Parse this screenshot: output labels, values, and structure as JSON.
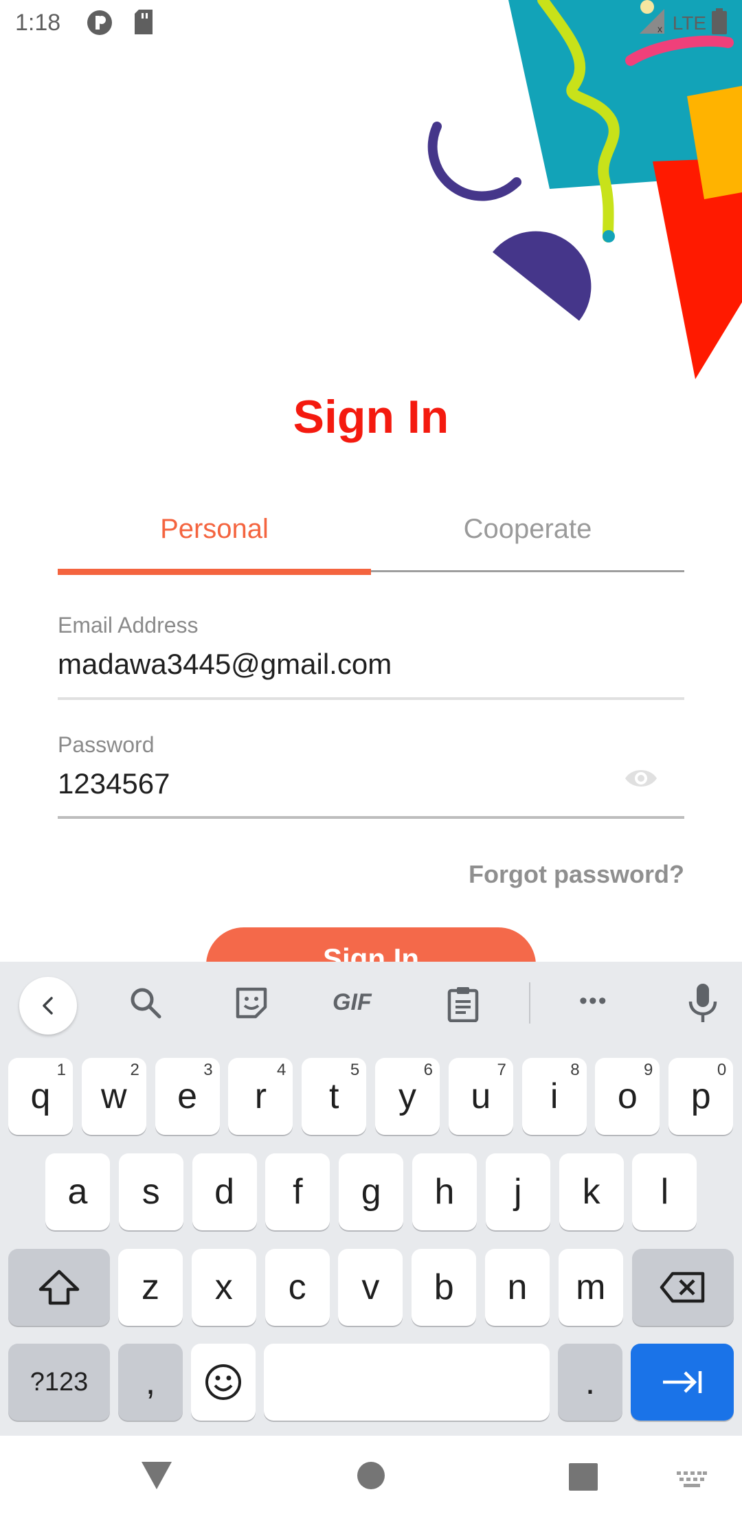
{
  "status_bar": {
    "time": "1:18",
    "icons": [
      "app-icon",
      "sd-card-icon"
    ],
    "network": "LTE",
    "right_icons": [
      "signal-icon",
      "battery-icon"
    ]
  },
  "colors": {
    "accent": "#f4643f",
    "title_red": "#f41a0f",
    "keyboard_bg": "#e8eaed",
    "enter_key": "#1a73e8"
  },
  "signin": {
    "title": "Sign In",
    "tabs": [
      {
        "label": "Personal",
        "selected": true
      },
      {
        "label": "Cooperate",
        "selected": false
      }
    ],
    "email": {
      "label": "Email Address",
      "value": "madawa3445@gmail.com"
    },
    "password": {
      "label": "Password",
      "value": "1234567",
      "toggle_icon": "eye-icon"
    },
    "forgot_label": "Forgot password?",
    "button_label": "Sign In"
  },
  "keyboard": {
    "toolbar_icons": [
      "back-icon",
      "search-icon",
      "sticker-icon",
      "gif-icon",
      "clipboard-icon",
      "more-icon",
      "mic-icon"
    ],
    "gif_label": "GIF",
    "more_label": "•••",
    "row1": [
      {
        "k": "q",
        "h": "1"
      },
      {
        "k": "w",
        "h": "2"
      },
      {
        "k": "e",
        "h": "3"
      },
      {
        "k": "r",
        "h": "4"
      },
      {
        "k": "t",
        "h": "5"
      },
      {
        "k": "y",
        "h": "6"
      },
      {
        "k": "u",
        "h": "7"
      },
      {
        "k": "i",
        "h": "8"
      },
      {
        "k": "o",
        "h": "9"
      },
      {
        "k": "p",
        "h": "0"
      }
    ],
    "row2": [
      "a",
      "s",
      "d",
      "f",
      "g",
      "h",
      "j",
      "k",
      "l"
    ],
    "row3": [
      "z",
      "x",
      "c",
      "v",
      "b",
      "n",
      "m"
    ],
    "symbols_label": "?123",
    "comma": ",",
    "period": "."
  },
  "navbar": {
    "icons": [
      "back-triangle-icon",
      "home-circle-icon",
      "recents-square-icon",
      "keyboard-switch-icon"
    ]
  }
}
